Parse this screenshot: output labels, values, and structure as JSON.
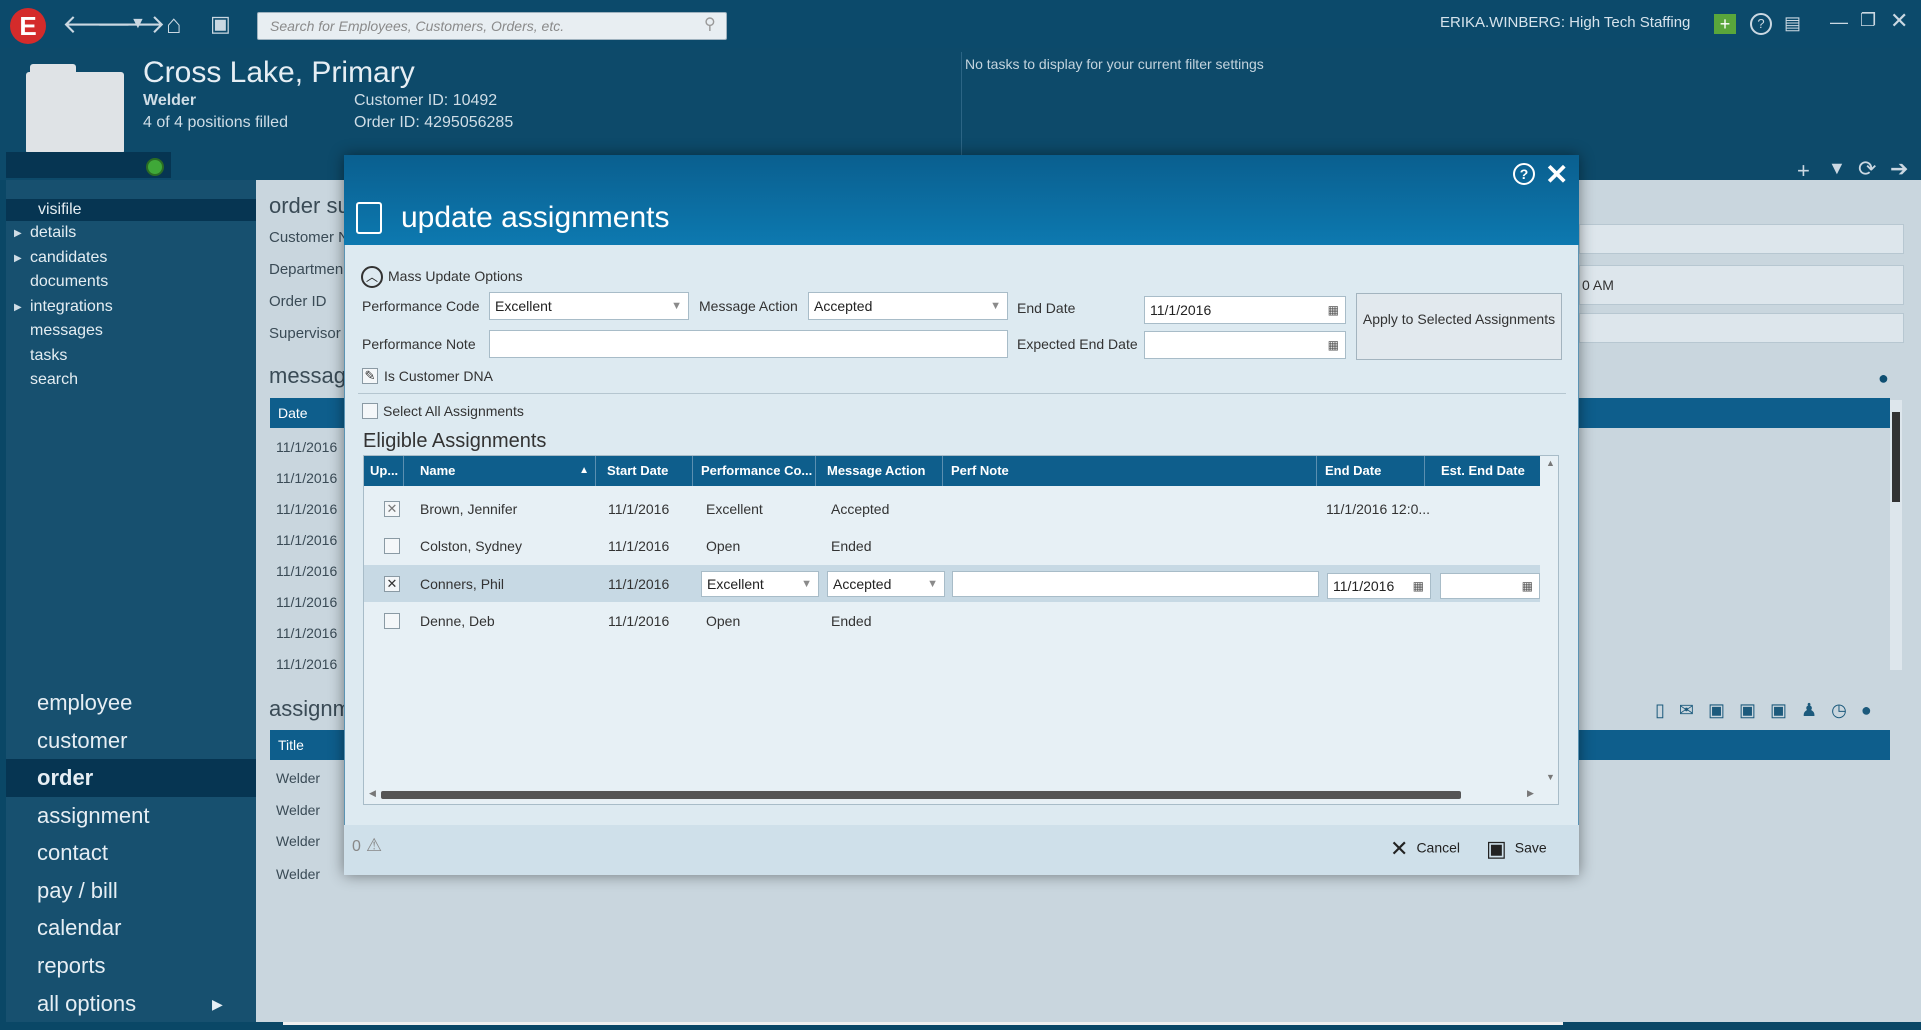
{
  "topbar": {
    "logo": "E",
    "search_placeholder": "Search for Employees, Customers, Orders, etc.",
    "user": "ERIKA.WINBERG: High Tech Staffing",
    "icons": [
      "back-arrow-icon",
      "forward-arrow-icon",
      "dropdown-icon",
      "home-icon",
      "save-icon",
      "search-icon",
      "add-icon",
      "help-icon",
      "feedback-icon",
      "minimize-icon",
      "restore-icon",
      "close-icon"
    ]
  },
  "header": {
    "title": "Cross Lake, Primary",
    "job": "Welder",
    "positions": "4 of 4 positions filled",
    "customer_id": "Customer ID:  10492",
    "order_id": "Order ID:  4295056285",
    "tasks_msg": "No tasks to display for your current filter settings"
  },
  "nav": {
    "small": [
      "visifile",
      "details",
      "candidates",
      "documents",
      "integrations",
      "messages",
      "tasks",
      "search"
    ],
    "big": [
      "employee",
      "customer",
      "order",
      "assignment",
      "contact",
      "pay / bill",
      "calendar",
      "reports",
      "all options"
    ]
  },
  "background": {
    "order_summary": "order su",
    "labels": [
      "Customer N",
      "Departmen",
      "Order ID",
      "Supervisor"
    ],
    "time_frag": "0 AM",
    "messages": "message",
    "msg_col": "Date",
    "msg_dates": [
      "11/1/2016",
      "11/1/2016",
      "11/1/2016",
      "11/1/2016",
      "11/1/2016",
      "11/1/2016",
      "11/1/2016",
      "11/1/2016"
    ],
    "assignments": "assignm",
    "asg_col": "Title",
    "asg_titles": [
      "Welder",
      "Welder",
      "Welder",
      "Welder"
    ]
  },
  "modal": {
    "title": "update assignments",
    "mass_label": "Mass Update Options",
    "perf_code_label": "Performance Code",
    "perf_code_value": "Excellent",
    "msg_action_label": "Message Action",
    "msg_action_value": "Accepted",
    "end_date_label": "End Date",
    "end_date_value": "11/1/2016",
    "perf_note_label": "Performance Note",
    "exp_end_label": "Expected End Date",
    "apply_btn": "Apply to Selected Assignments",
    "dna_label": "Is Customer DNA",
    "select_all": "Select All Assignments",
    "eligible_title": "Eligible Assignments",
    "columns": [
      "Up...",
      "Name",
      "Start Date",
      "Performance Co...",
      "Message Action",
      "Perf Note",
      "End Date",
      "Est. End Date"
    ],
    "rows": [
      {
        "name": "Brown, Jennifer",
        "start": "11/1/2016",
        "perf": "Excellent",
        "action": "Accepted",
        "end": "11/1/2016 12:0...",
        "check": "✕"
      },
      {
        "name": "Colston, Sydney",
        "start": "11/1/2016",
        "perf": "Open",
        "action": "Ended",
        "end": "",
        "check": ""
      },
      {
        "name": "Conners, Phil",
        "start": "11/1/2016",
        "perf": "Excellent",
        "action": "Accepted",
        "end": "11/1/2016",
        "check": "✕"
      },
      {
        "name": "Denne, Deb",
        "start": "11/1/2016",
        "perf": "Open",
        "action": "Ended",
        "end": "",
        "check": ""
      }
    ],
    "warning_count": "0",
    "cancel": "Cancel",
    "save": "Save"
  }
}
